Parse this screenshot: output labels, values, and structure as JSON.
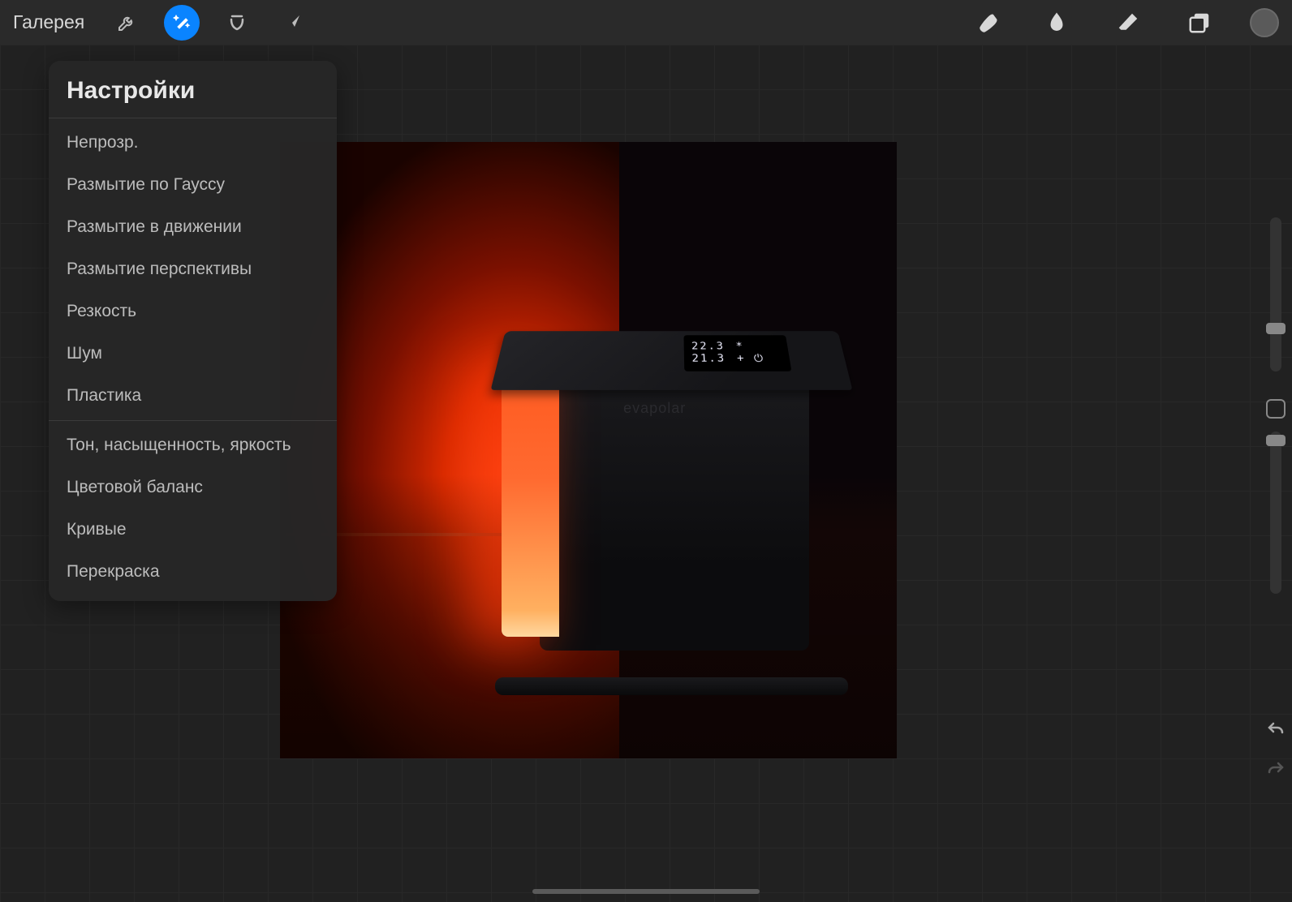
{
  "toolbar": {
    "gallery_label": "Галерея"
  },
  "panel": {
    "title": "Настройки",
    "section1": [
      "Непрозр.",
      "Размытие по Гауссу",
      "Размытие в движении",
      "Размытие перспективы",
      "Резкость",
      "Шум",
      "Пластика"
    ],
    "section2": [
      "Тон, насыщенность, яркость",
      "Цветовой баланс",
      "Кривые",
      "Перекраска"
    ]
  },
  "device": {
    "line1": "22.3",
    "line2": "21.3",
    "brand": "evapolar"
  },
  "icons": {
    "wrench": "wrench-icon",
    "wand": "wand-icon",
    "selection": "selection-icon",
    "arrow": "transform-arrow-icon",
    "brush": "brush-icon",
    "smudge": "smudge-icon",
    "eraser": "eraser-icon",
    "layers": "layers-icon",
    "color": "color-swatch"
  }
}
